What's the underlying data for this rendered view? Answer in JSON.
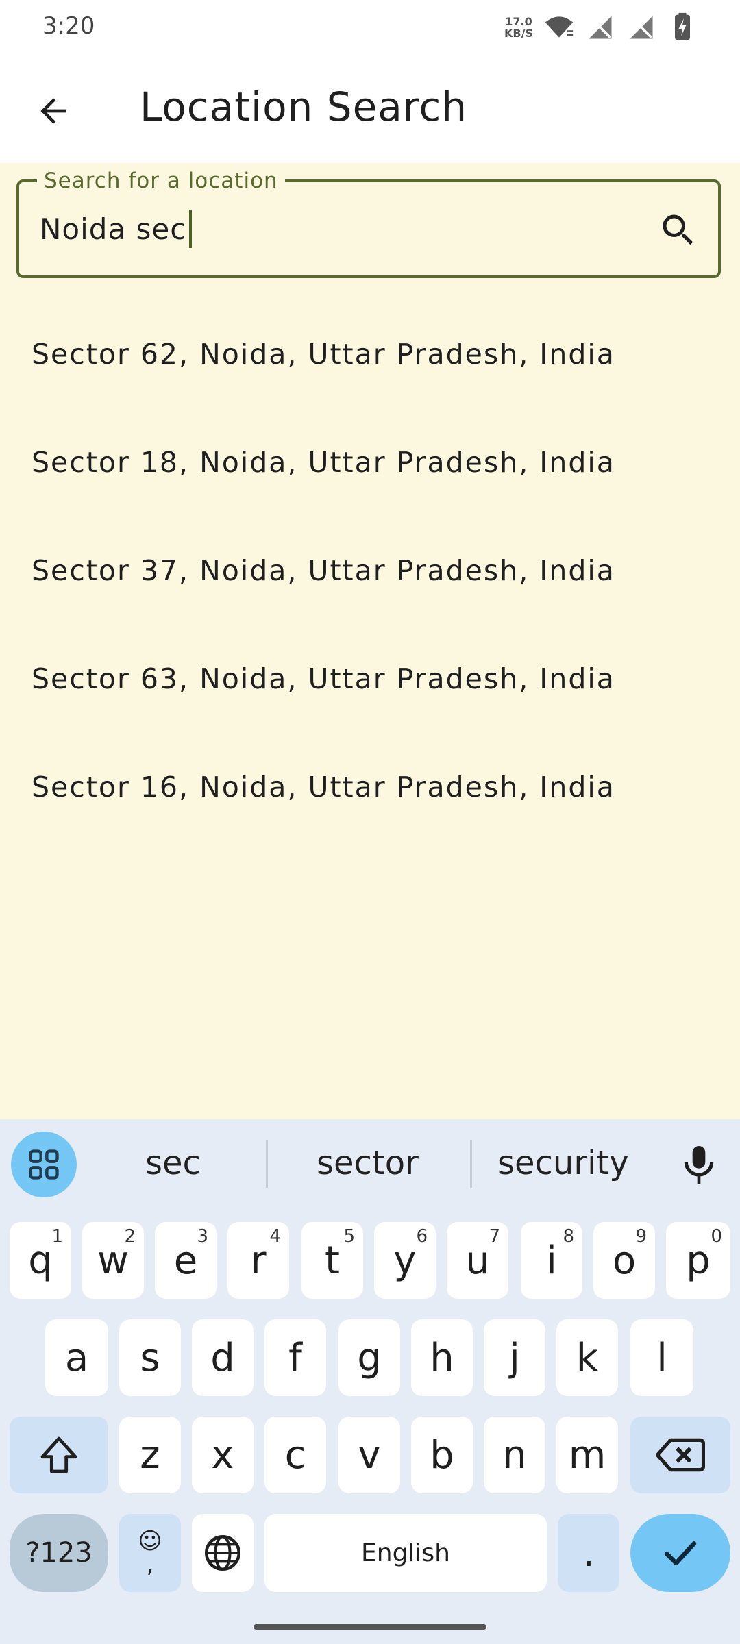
{
  "status_bar": {
    "time": "3:20",
    "net_speed_value": "17.0",
    "net_speed_unit": "KB/S",
    "icons": [
      "wifi-icon",
      "signal-off-icon",
      "signal-off-icon",
      "battery-charging-icon"
    ]
  },
  "app_bar": {
    "title": "Location Search",
    "back_icon": "arrow-back-icon"
  },
  "search": {
    "label": "Search for a location",
    "value": "Noida sec",
    "icon": "search-icon"
  },
  "results": [
    {
      "label": "Sector 62, Noida, Uttar Pradesh, India"
    },
    {
      "label": "Sector 18, Noida, Uttar Pradesh, India"
    },
    {
      "label": "Sector 37, Noida, Uttar Pradesh, India"
    },
    {
      "label": "Sector 63, Noida, Uttar Pradesh, India"
    },
    {
      "label": "Sector 16, Noida, Uttar Pradesh, India"
    }
  ],
  "keyboard": {
    "suggestions": [
      "sec",
      "sector",
      "security"
    ],
    "row1": [
      {
        "key": "q",
        "sup": "1"
      },
      {
        "key": "w",
        "sup": "2"
      },
      {
        "key": "e",
        "sup": "3"
      },
      {
        "key": "r",
        "sup": "4"
      },
      {
        "key": "t",
        "sup": "5"
      },
      {
        "key": "y",
        "sup": "6"
      },
      {
        "key": "u",
        "sup": "7"
      },
      {
        "key": "i",
        "sup": "8"
      },
      {
        "key": "o",
        "sup": "9"
      },
      {
        "key": "p",
        "sup": "0"
      }
    ],
    "row2": [
      "a",
      "s",
      "d",
      "f",
      "g",
      "h",
      "j",
      "k",
      "l"
    ],
    "row3": [
      "z",
      "x",
      "c",
      "v",
      "b",
      "n",
      "m"
    ],
    "symbols_label": "?123",
    "emoji_top": "☺",
    "comma": ",",
    "space_label": "English",
    "period": ".",
    "colors": {
      "accent": "#74c7f5",
      "modifier": "#cfe1f4",
      "background": "#e6ecf6"
    }
  },
  "theme": {
    "content_background": "#fcf8df",
    "field_border": "#5a6a2f"
  }
}
